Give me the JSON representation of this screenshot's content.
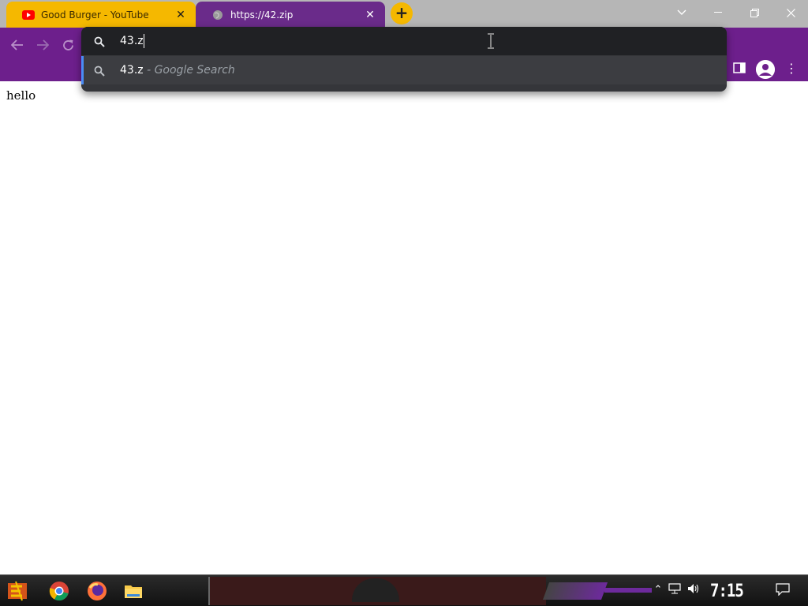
{
  "colors": {
    "youtube_tab": "#f5b800",
    "active_tab": "#6a2b8a",
    "toolbar": "#6d1f8c",
    "omnibox_bg": "#35363a",
    "suggestion_accent": "#4a8cf7",
    "youtube_red": "#ff0000"
  },
  "tabs": [
    {
      "title": "Good Burger - YouTube",
      "icon": "youtube-icon",
      "active": false
    },
    {
      "title": "https://42.zip",
      "icon": "globe-icon",
      "active": true
    }
  ],
  "omnibox": {
    "value": "43.z",
    "suggestions": [
      {
        "icon": "search-icon",
        "query": "43.z",
        "suffix": " - Google Search"
      }
    ]
  },
  "page": {
    "body_text": "hello"
  },
  "taskbar": {
    "clock": "7:15 PM",
    "apps": [
      "start-icon",
      "chrome-icon",
      "firefox-icon",
      "file-explorer-icon"
    ]
  }
}
